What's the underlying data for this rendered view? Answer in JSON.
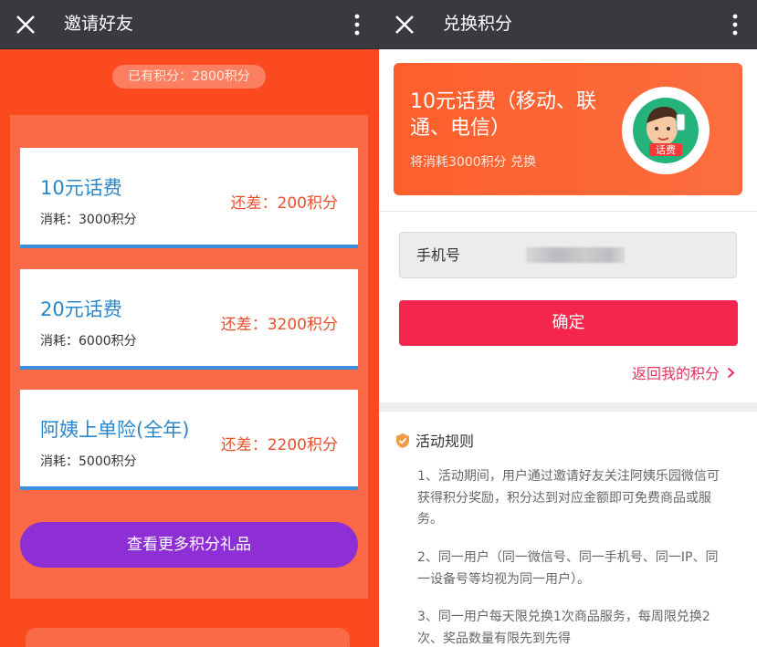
{
  "left": {
    "title": "邀请好友",
    "points_badge": "已有积分：2800积分",
    "cards": [
      {
        "name": "10元话费",
        "cost": "消耗：3000积分",
        "diff": "还差：200积分"
      },
      {
        "name": "20元话费",
        "cost": "消耗：6000积分",
        "diff": "还差：3200积分"
      },
      {
        "name": "阿姨上单险(全年)",
        "cost": "消耗：5000积分",
        "diff": "还差：2200积分"
      }
    ],
    "more_button": "查看更多积分礼品"
  },
  "right": {
    "title": "兑换积分",
    "product": {
      "name": "10元话费（移动、联通、电信）",
      "cost": "将消耗3000积分 兑换",
      "badge_text": "话费"
    },
    "phone_label": "手机号",
    "phone_value": "",
    "confirm_button": "确定",
    "back_link": "返回我的积分",
    "rules_title": "活动规则",
    "rules": [
      "1、活动期间，用户通过邀请好友关注阿姨乐园微信可获得积分奖励，积分达到对应金额即可免费商品或服务。",
      "2、同一用户（同一微信号、同一手机号、同一IP、同一设备号等均视为同一用户）。",
      "3、同一用户每天限兑换1次商品服务，每周限兑换2次、奖品数量有限先到先得"
    ]
  },
  "icons": {
    "close": "close-icon",
    "more": "more-vertical-icon",
    "shield": "shield-check-icon",
    "chevron": "chevron-right-icon"
  },
  "colors": {
    "titlebar": "#393a3f",
    "page_orange": "#fc4a1f",
    "card_area": "#fb6a46",
    "card_accent": "#3c8fdc",
    "card_name": "#2b87cb",
    "diff_red": "#e7502c",
    "purple_button": "#8d2fd4",
    "confirm_red": "#f5264d",
    "link_red": "#e2355e"
  }
}
